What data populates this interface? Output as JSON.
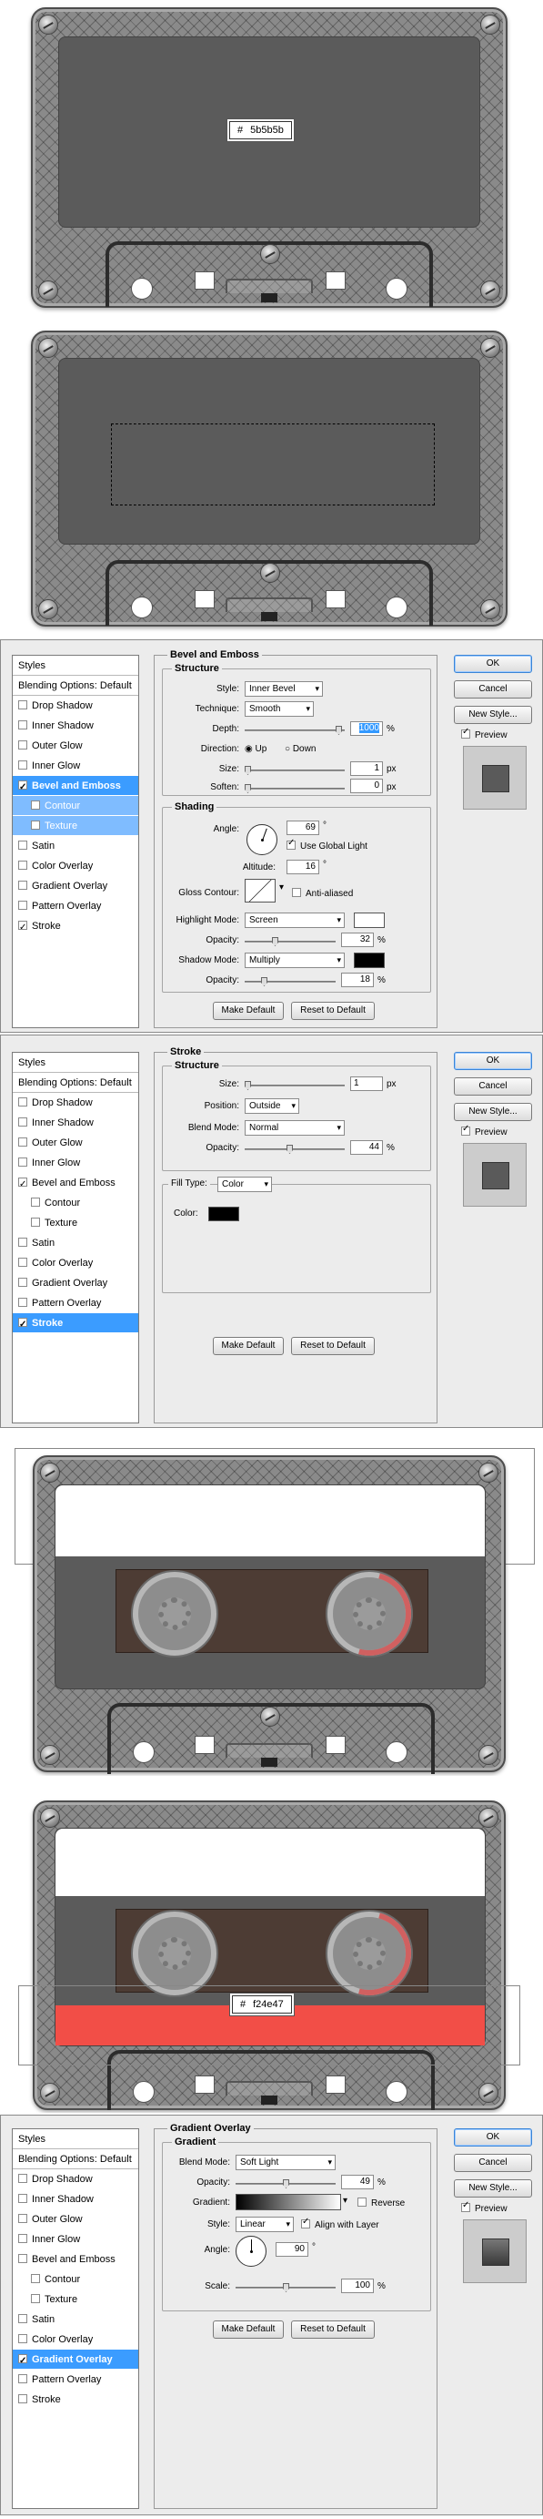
{
  "section1": {
    "hex_hash": "#",
    "hex_value": "5b5b5b"
  },
  "section2": {},
  "dialog1": {
    "styles_header": "Styles",
    "items": [
      {
        "label": "Blending Options: Default",
        "kind": "hdr"
      },
      {
        "label": "Drop Shadow",
        "checked": false
      },
      {
        "label": "Inner Shadow",
        "checked": false
      },
      {
        "label": "Outer Glow",
        "checked": false
      },
      {
        "label": "Inner Glow",
        "checked": false
      },
      {
        "label": "Bevel and Emboss",
        "checked": true,
        "selected": true
      },
      {
        "label": "Contour",
        "checked": false,
        "sub": true
      },
      {
        "label": "Texture",
        "checked": false,
        "sub": true
      },
      {
        "label": "Satin",
        "checked": false
      },
      {
        "label": "Color Overlay",
        "checked": false
      },
      {
        "label": "Gradient Overlay",
        "checked": false
      },
      {
        "label": "Pattern Overlay",
        "checked": false
      },
      {
        "label": "Stroke",
        "checked": true
      }
    ],
    "title": "Bevel and Emboss",
    "structure_title": "Structure",
    "style_label": "Style:",
    "style_value": "Inner Bevel",
    "technique_label": "Technique:",
    "technique_value": "Smooth",
    "depth_label": "Depth:",
    "depth_value": "1000",
    "depth_unit": "%",
    "direction_label": "Direction:",
    "dir_up": "Up",
    "dir_down": "Down",
    "size_label": "Size:",
    "size_value": "1",
    "size_unit": "px",
    "soften_label": "Soften:",
    "soften_value": "0",
    "soften_unit": "px",
    "shading_title": "Shading",
    "angle_label": "Angle:",
    "angle_value": "69",
    "angle_unit": "°",
    "use_global": "Use Global Light",
    "altitude_label": "Altitude:",
    "altitude_value": "16",
    "altitude_unit": "°",
    "gloss_label": "Gloss Contour:",
    "anti_aliased": "Anti-aliased",
    "highlight_label": "Highlight Mode:",
    "highlight_value": "Screen",
    "hl_opacity_label": "Opacity:",
    "hl_opacity_value": "32",
    "hl_opacity_unit": "%",
    "shadow_label": "Shadow Mode:",
    "shadow_value": "Multiply",
    "sh_opacity_label": "Opacity:",
    "sh_opacity_value": "18",
    "sh_opacity_unit": "%",
    "make_default": "Make Default",
    "reset_default": "Reset to Default",
    "ok": "OK",
    "cancel": "Cancel",
    "new_style": "New Style...",
    "preview": "Preview",
    "highlight_color": "#ffffff",
    "shadow_color": "#000000"
  },
  "dialog2": {
    "styles_header": "Styles",
    "items": [
      {
        "label": "Blending Options: Default",
        "kind": "hdr"
      },
      {
        "label": "Drop Shadow",
        "checked": false
      },
      {
        "label": "Inner Shadow",
        "checked": false
      },
      {
        "label": "Outer Glow",
        "checked": false
      },
      {
        "label": "Inner Glow",
        "checked": false
      },
      {
        "label": "Bevel and Emboss",
        "checked": true
      },
      {
        "label": "Contour",
        "checked": false,
        "sub": true
      },
      {
        "label": "Texture",
        "checked": false,
        "sub": true
      },
      {
        "label": "Satin",
        "checked": false
      },
      {
        "label": "Color Overlay",
        "checked": false
      },
      {
        "label": "Gradient Overlay",
        "checked": false
      },
      {
        "label": "Pattern Overlay",
        "checked": false
      },
      {
        "label": "Stroke",
        "checked": true,
        "selected": true
      }
    ],
    "title": "Stroke",
    "structure_title": "Structure",
    "size_label": "Size:",
    "size_value": "1",
    "size_unit": "px",
    "position_label": "Position:",
    "position_value": "Outside",
    "blend_label": "Blend Mode:",
    "blend_value": "Normal",
    "opacity_label": "Opacity:",
    "opacity_value": "44",
    "opacity_unit": "%",
    "fill_label": "Fill Type:",
    "fill_value": "Color",
    "color_label": "Color:",
    "color_value": "#000000",
    "make_default": "Make Default",
    "reset_default": "Reset to Default",
    "ok": "OK",
    "cancel": "Cancel",
    "new_style": "New Style...",
    "preview": "Preview"
  },
  "section5": {},
  "section6": {
    "hex_hash": "#",
    "hex_value": "f24e47",
    "stripe_color": "#f24e47"
  },
  "dialog3": {
    "styles_header": "Styles",
    "items": [
      {
        "label": "Blending Options: Default",
        "kind": "hdr"
      },
      {
        "label": "Drop Shadow",
        "checked": false
      },
      {
        "label": "Inner Shadow",
        "checked": false
      },
      {
        "label": "Outer Glow",
        "checked": false
      },
      {
        "label": "Inner Glow",
        "checked": false
      },
      {
        "label": "Bevel and Emboss",
        "checked": false
      },
      {
        "label": "Contour",
        "checked": false,
        "sub": true
      },
      {
        "label": "Texture",
        "checked": false,
        "sub": true
      },
      {
        "label": "Satin",
        "checked": false
      },
      {
        "label": "Color Overlay",
        "checked": false
      },
      {
        "label": "Gradient Overlay",
        "checked": true,
        "selected": true
      },
      {
        "label": "Pattern Overlay",
        "checked": false
      },
      {
        "label": "Stroke",
        "checked": false
      }
    ],
    "title": "Gradient Overlay",
    "gradient_title": "Gradient",
    "blend_label": "Blend Mode:",
    "blend_value": "Soft Light",
    "opacity_label": "Opacity:",
    "opacity_value": "49",
    "opacity_unit": "%",
    "gradient_label": "Gradient:",
    "reverse": "Reverse",
    "style_label": "Style:",
    "style_value": "Linear",
    "align": "Align with Layer",
    "angle_label": "Angle:",
    "angle_value": "90",
    "angle_unit": "°",
    "scale_label": "Scale:",
    "scale_value": "100",
    "scale_unit": "%",
    "make_default": "Make Default",
    "reset_default": "Reset to Default",
    "ok": "OK",
    "cancel": "Cancel",
    "new_style": "New Style...",
    "preview": "Preview"
  }
}
